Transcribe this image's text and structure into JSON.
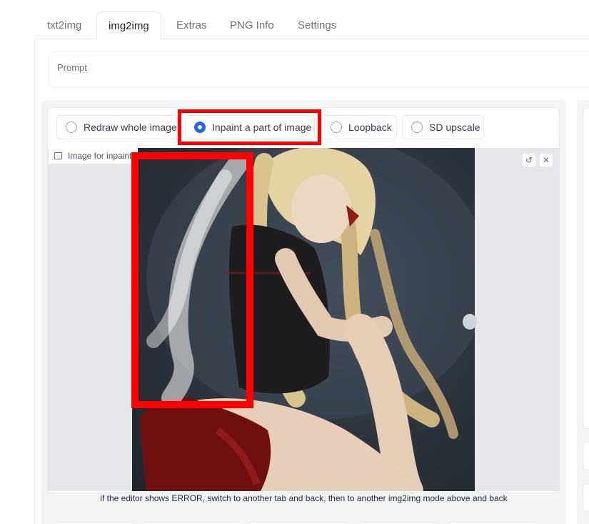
{
  "tabs": [
    {
      "label": "txt2img",
      "active": false
    },
    {
      "label": "img2img",
      "active": true
    },
    {
      "label": "Extras",
      "active": false
    },
    {
      "label": "PNG Info",
      "active": false
    },
    {
      "label": "Settings",
      "active": false
    }
  ],
  "prompt": {
    "placeholder": "Prompt"
  },
  "mode_options": [
    {
      "label": "Redraw whole image",
      "selected": false
    },
    {
      "label": "Inpaint a part of image",
      "selected": true
    },
    {
      "label": "Loopback",
      "selected": false
    },
    {
      "label": "SD upscale",
      "selected": false
    }
  ],
  "image_panel": {
    "label": "Image for inpainti",
    "icons": [
      "image-icon",
      "undo-icon",
      "close-icon"
    ]
  },
  "hint": "if the editor shows ERROR, switch to another tab and back, then to another img2img mode above and back",
  "colors": {
    "accent": "#2563eb",
    "highlight": "#ff0000"
  }
}
